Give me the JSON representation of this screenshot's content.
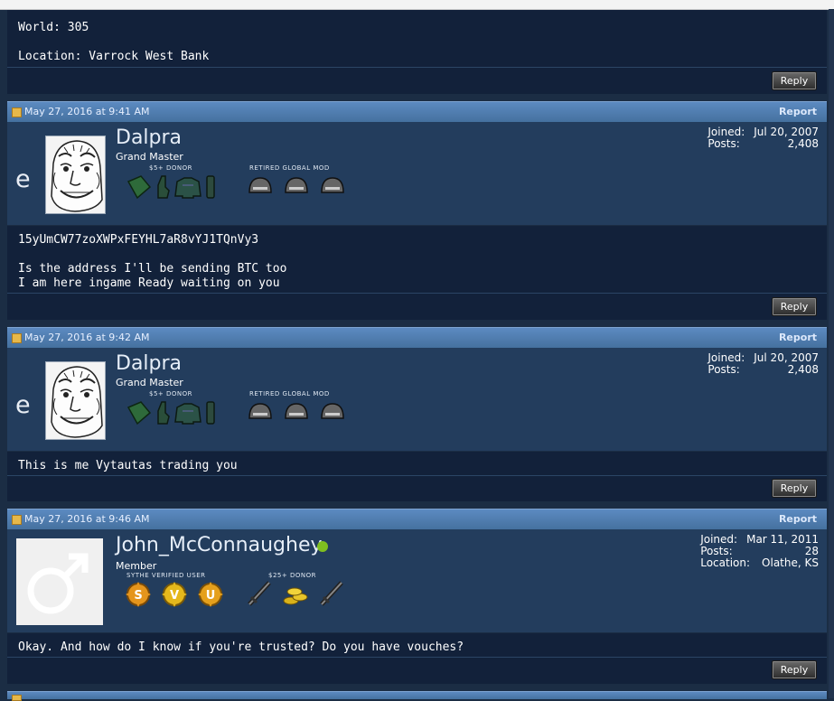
{
  "post0": {
    "lines": [
      "World: 305",
      "",
      "Location: Varrock West Bank"
    ],
    "reply_label": "Reply"
  },
  "post1": {
    "date": "May 27, 2016 at 9:41 AM",
    "report_label": "Report",
    "username": "Dalpra",
    "usertitle": "Grand Master",
    "avatar_letter": "e",
    "rank1_label": "$5+ DONOR",
    "rank2_label": "RETIRED GLOBAL MOD",
    "joined_label": "Joined:",
    "joined_value": "Jul 20, 2007",
    "posts_label": "Posts:",
    "posts_value": "2,408",
    "lines": [
      "15yUmCW77zoXWPxFEYHL7aR8vYJ1TQnVy3",
      "",
      "Is the address I'll be sending BTC too",
      "I am here ingame Ready waiting on you"
    ],
    "reply_label": "Reply"
  },
  "post2": {
    "date": "May 27, 2016 at 9:42 AM",
    "report_label": "Report",
    "username": "Dalpra",
    "usertitle": "Grand Master",
    "avatar_letter": "e",
    "rank1_label": "$5+ DONOR",
    "rank2_label": "RETIRED GLOBAL MOD",
    "joined_label": "Joined:",
    "joined_value": "Jul 20, 2007",
    "posts_label": "Posts:",
    "posts_value": "2,408",
    "lines": [
      "This is me Vytautas trading you"
    ],
    "reply_label": "Reply"
  },
  "post3": {
    "date": "May 27, 2016 at 9:46 AM",
    "report_label": "Report",
    "username": "John_McConnaughey",
    "online_color": "#7fbf1f",
    "usertitle": "Member",
    "rank1_label": "SYTHE VERIFIED USER",
    "rank2_label": "$25+ DONOR",
    "joined_label": "Joined:",
    "joined_value": "Mar 11, 2011",
    "posts_label": "Posts:",
    "posts_value": "28",
    "location_label": "Location:",
    "location_value": "Olathe, KS",
    "lines": [
      "Okay. And how do I know if you're trusted? Do you have vouches?"
    ],
    "reply_label": "Reply"
  },
  "colors": {
    "page_bg": "#1b2d44",
    "header_bg": "#5080b8",
    "userinfo_bg": "#233d5d",
    "message_bg": "#12213a"
  }
}
